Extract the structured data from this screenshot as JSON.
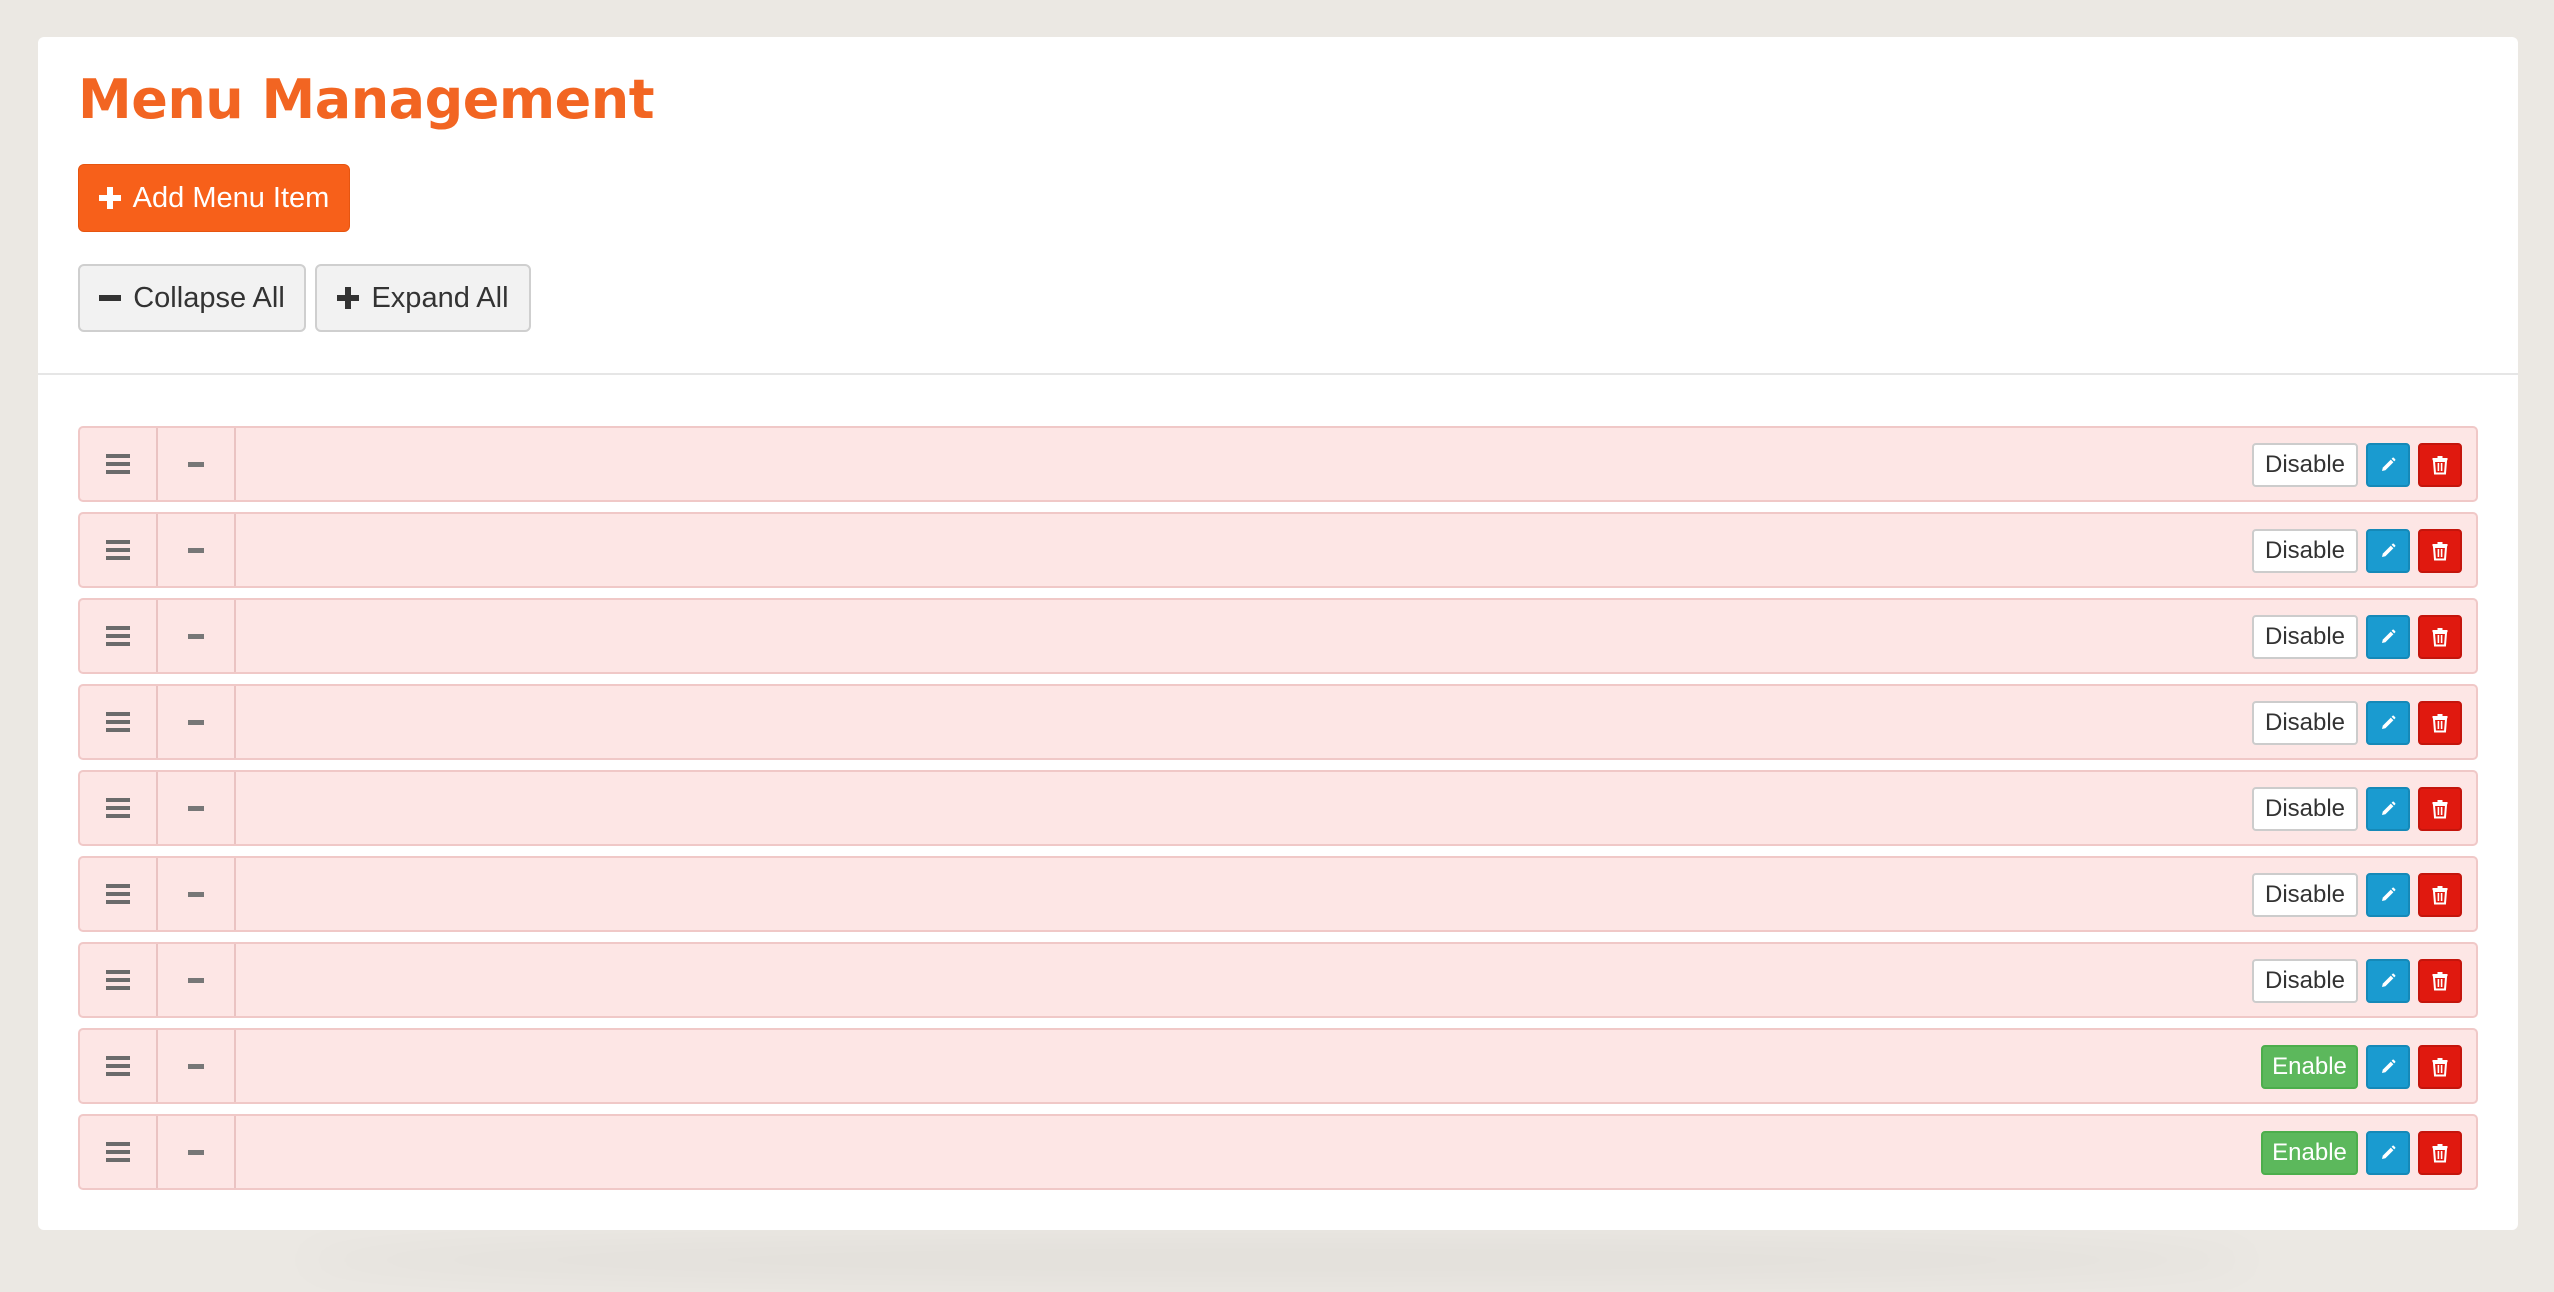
{
  "page": {
    "title": "Menu Management",
    "accent_color": "#f26522"
  },
  "toolbar": {
    "add_label": "Add Menu Item",
    "add_icon": "plus-icon",
    "collapse_label": "Collapse All",
    "collapse_icon": "minus-icon",
    "expand_label": "Expand All",
    "expand_icon": "plus-icon"
  },
  "menu_items": [
    {
      "state_label": "Disable",
      "state": "enabled"
    },
    {
      "state_label": "Disable",
      "state": "enabled"
    },
    {
      "state_label": "Disable",
      "state": "enabled"
    },
    {
      "state_label": "Disable",
      "state": "enabled"
    },
    {
      "state_label": "Disable",
      "state": "enabled"
    },
    {
      "state_label": "Disable",
      "state": "enabled"
    },
    {
      "state_label": "Disable",
      "state": "enabled"
    },
    {
      "state_label": "Enable",
      "state": "disabled"
    },
    {
      "state_label": "Enable",
      "state": "disabled"
    }
  ],
  "row_icons": {
    "drag": "drag-handle-icon",
    "toggle": "collapse-minus-icon",
    "edit": "pencil-icon",
    "delete": "trash-icon"
  },
  "colors": {
    "row_background": "#fde6e5",
    "edit": "#1a9bd0",
    "delete": "#e0190f",
    "enable": "#5cb85c"
  }
}
